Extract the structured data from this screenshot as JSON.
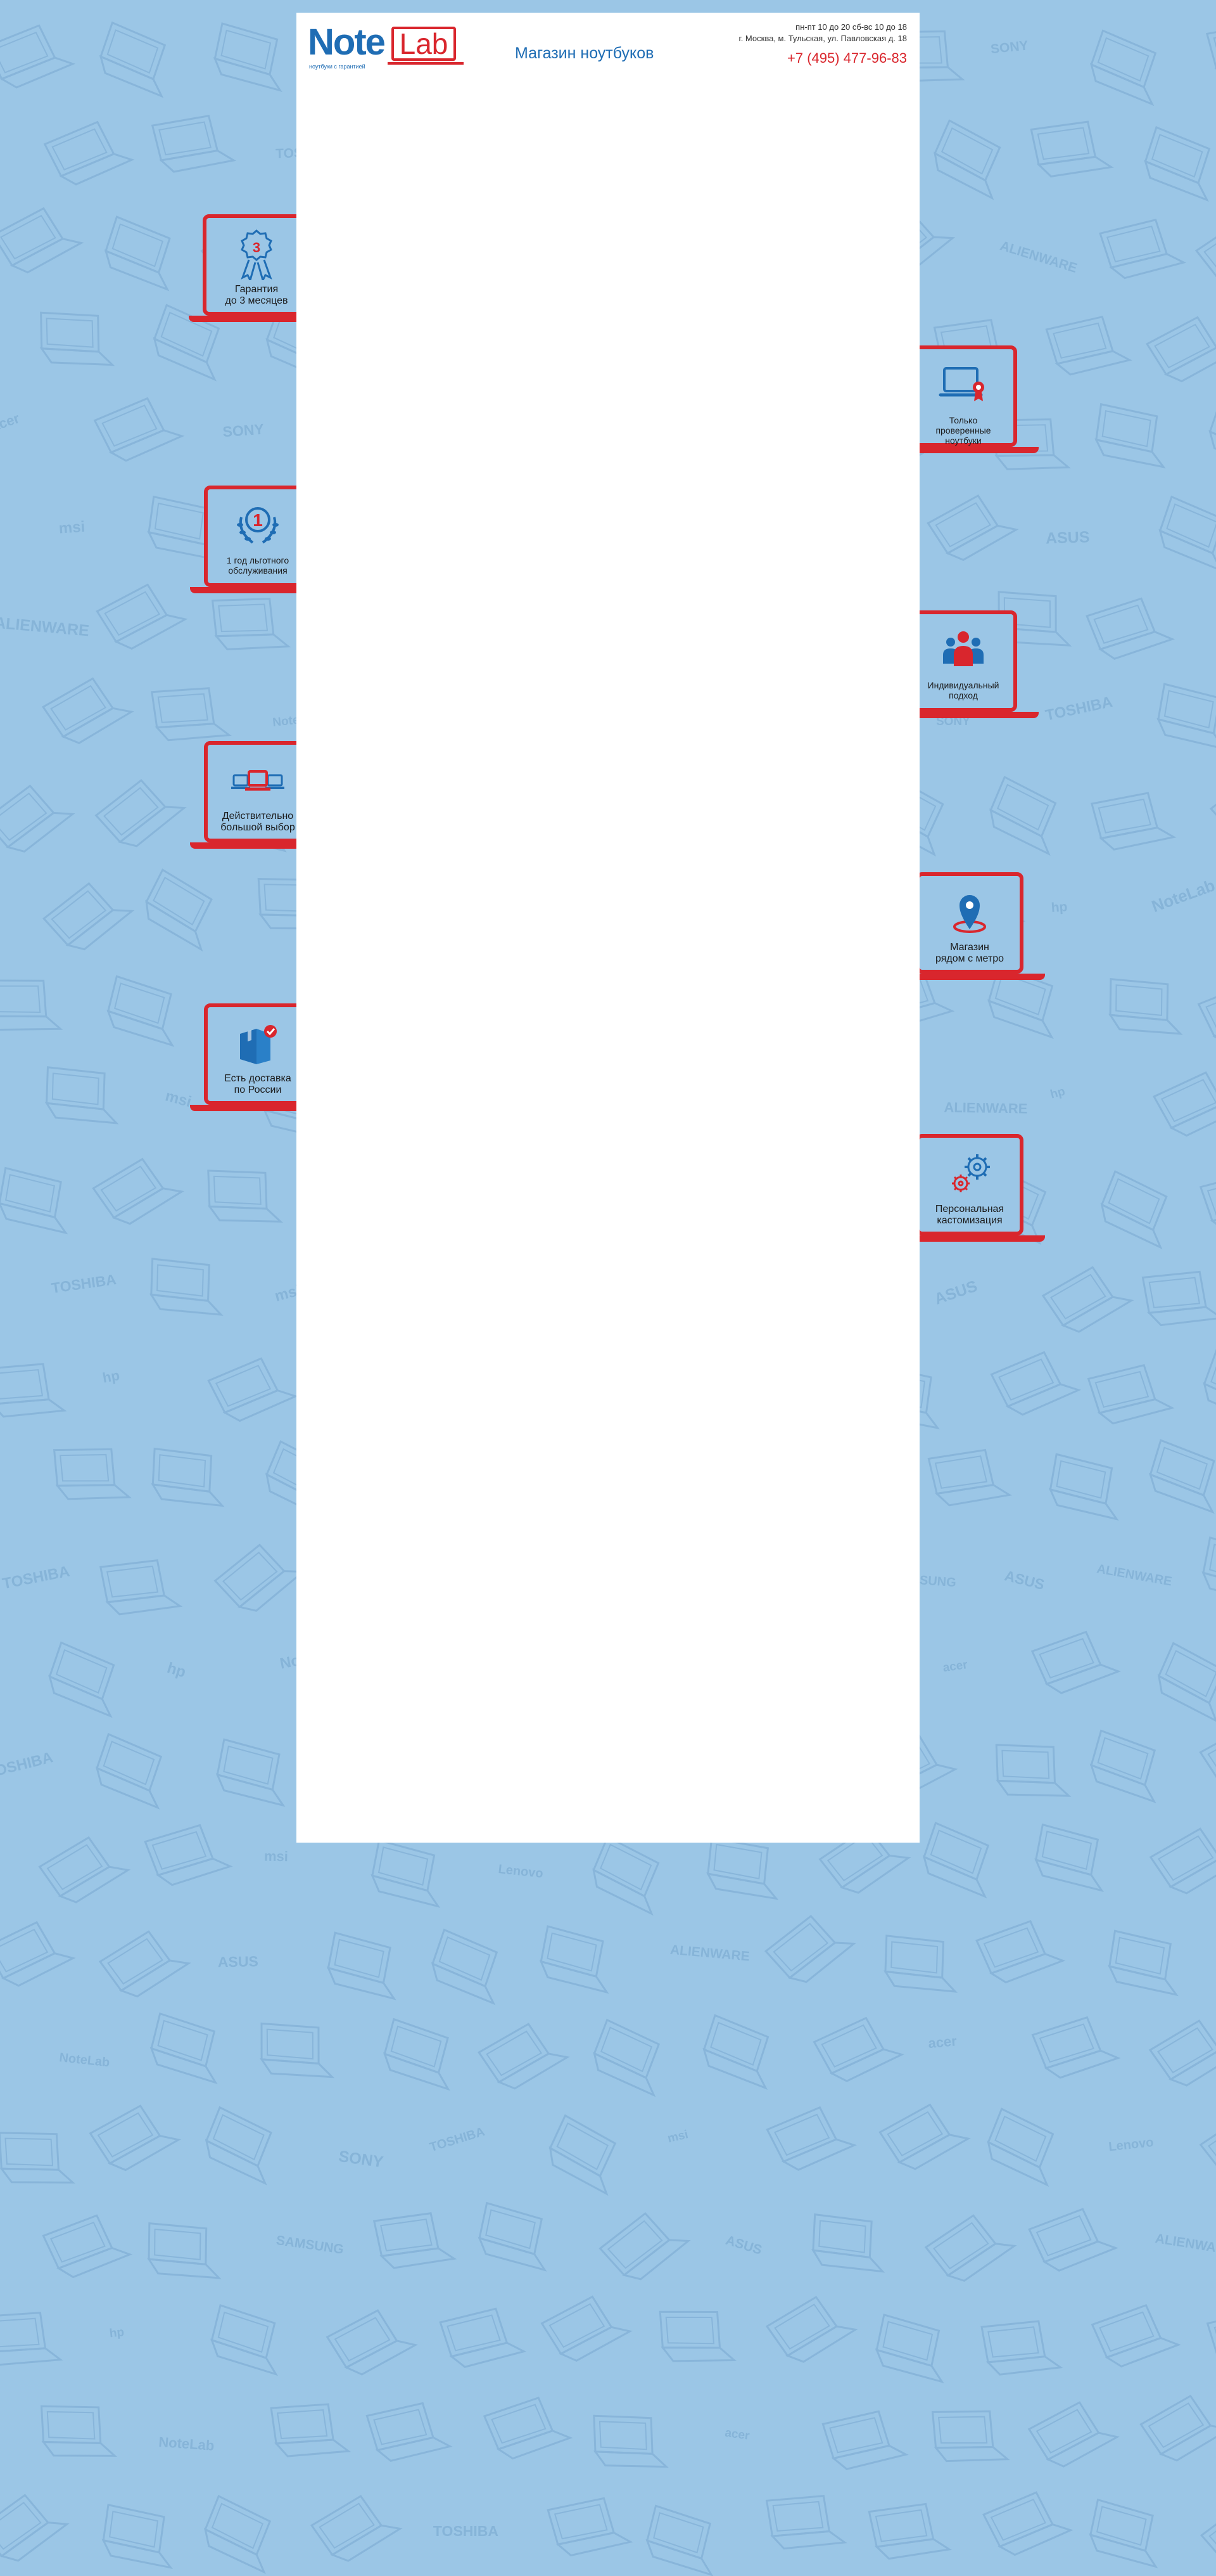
{
  "header": {
    "logo": {
      "note": "Note",
      "lab": "Lab",
      "tagline": "ноутбуки с гарантией"
    },
    "shop_title": "Магазин ноутбуков",
    "hours": "пн-пт 10 до 20 сб-вс 10 до 18",
    "address": "г. Москва, м. Тульская, ул. Павловская д. 18",
    "phone": "+7 (495) 477-96-83"
  },
  "features": [
    {
      "label": "Гарантия до 3 месяцев",
      "line1": "Гарантия",
      "line2": "до 3 месяцев",
      "icon": "medal-3-icon"
    },
    {
      "label": "Только проверенные ноутбуки",
      "line1": "Только",
      "line2": "проверенные",
      "line3": "ноутбуки",
      "icon": "verified-laptop-icon"
    },
    {
      "label": "1 год льготного обслуживания",
      "line1": "1 год льготного",
      "line2": "обслуживания",
      "icon": "laurel-1-icon"
    },
    {
      "label": "Индивидуальный подход",
      "line1": "Индивидуальный",
      "line2": "подход",
      "icon": "people-icon"
    },
    {
      "label": "Действительно большой выбор",
      "line1": "Действительно",
      "line2": "большой выбор",
      "icon": "laptops-icon"
    },
    {
      "label": "Магазин рядом с метро",
      "line1": "Магазин",
      "line2": "рядом с метро",
      "icon": "map-pin-icon"
    },
    {
      "label": "Есть доставка по России",
      "line1": "Есть доставка",
      "line2": "по России",
      "icon": "delivery-box-icon"
    },
    {
      "label": "Персональная кастомизация",
      "line1": "Персональная",
      "line2": "кастомизация",
      "icon": "gears-icon"
    }
  ],
  "background_pattern_words": [
    "acer",
    "SONY",
    "TOSHIBA",
    "msi",
    "Lenovo",
    "SAMSUNG",
    "ASUS",
    "ALIENWARE",
    "hp",
    "NoteLab"
  ],
  "colors": {
    "background": "#9bc6e6",
    "brand_blue": "#1f6db4",
    "brand_red": "#d9262d",
    "panel": "#ffffff"
  }
}
